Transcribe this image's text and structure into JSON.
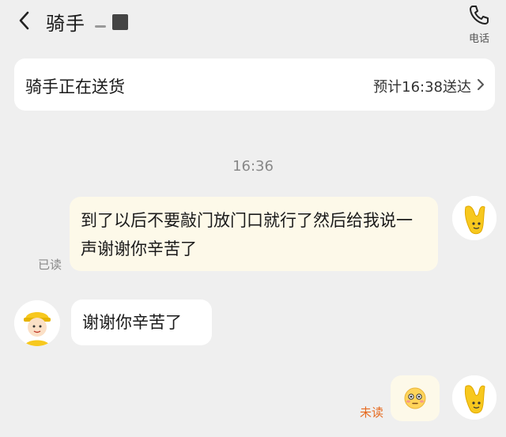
{
  "header": {
    "title": "骑手",
    "phone_label": "电话"
  },
  "status_card": {
    "status": "骑手正在送货",
    "eta": "预计16:38送达"
  },
  "chat": {
    "time": "16:36",
    "outgoing_message": "到了以后不要敲门放门口就行了然后给我说一声谢谢你辛苦了",
    "outgoing_read_status": "已读",
    "incoming_message": "谢谢你辛苦了",
    "outgoing_emoji_name": "flushed-face-emoji",
    "outgoing_emoji_read_status": "未读"
  },
  "colors": {
    "background": "#efefef",
    "outgoing_bubble": "#fdf9e9",
    "unread_text": "#e66a1f",
    "avatar_yellow": "#f7c81e"
  }
}
